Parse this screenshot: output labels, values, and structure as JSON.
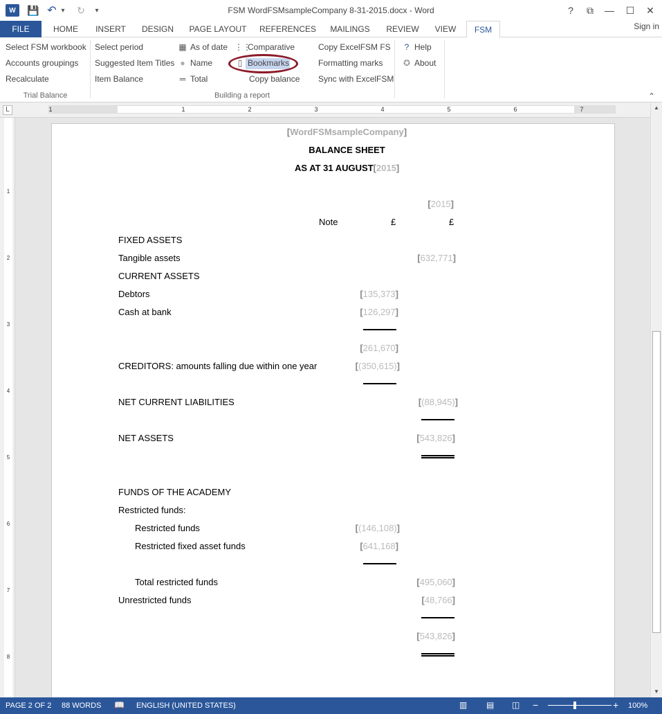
{
  "window": {
    "title": "FSM WordFSMsampleCompany 8-31-2015.docx - Word",
    "app_icon": "W",
    "help": "?",
    "restore": "⧉",
    "minimize": "—",
    "maximize": "☐",
    "close": "✕"
  },
  "quick_access": {
    "save": "💾",
    "undo": "↶",
    "undo_drop": "▾",
    "redo": "↻",
    "customize": "▾"
  },
  "tabs": [
    {
      "label": "FILE"
    },
    {
      "label": "HOME"
    },
    {
      "label": "INSERT"
    },
    {
      "label": "DESIGN"
    },
    {
      "label": "PAGE LAYOUT"
    },
    {
      "label": "REFERENCES"
    },
    {
      "label": "MAILINGS"
    },
    {
      "label": "REVIEW"
    },
    {
      "label": "VIEW"
    },
    {
      "label": "FSM"
    }
  ],
  "sign_in": "Sign in",
  "ribbon": {
    "trial_balance": {
      "label": "Trial Balance",
      "items": [
        "Select FSM workbook",
        "Accounts groupings",
        "Recalculate"
      ]
    },
    "building": {
      "label": "Building a report",
      "col1": [
        "Select period",
        "Suggested Item Titles",
        "Item Balance"
      ],
      "col2": [
        "As of date",
        "Name",
        "Total"
      ],
      "col3": [
        "Comparative",
        "Bookmarks",
        "Copy balance"
      ],
      "col4": [
        "Copy ExcelFSM FS",
        "Formatting marks",
        "Sync with ExcelFSM"
      ]
    },
    "help": {
      "items": [
        "Help",
        "About"
      ]
    },
    "collapse": "⌃"
  },
  "ruler": {
    "corner": "L",
    "numbers": [
      "1",
      "1",
      "2",
      "3",
      "4",
      "5",
      "6",
      "7"
    ]
  },
  "vruler": {
    "numbers": [
      "1",
      "2",
      "3",
      "4",
      "5",
      "6",
      "7",
      "8"
    ]
  },
  "document": {
    "company": "WordFSMsampleCompany",
    "heading": "BALANCE SHEET",
    "as_at": "AS AT 31 AUGUST",
    "year_bm": "2015",
    "col_year": "2015",
    "note_label": "Note",
    "currency1": "£",
    "currency2": "£",
    "rows": {
      "fixed_assets": "FIXED ASSETS",
      "tangible": "Tangible assets",
      "tangible_val": "632,771",
      "current_assets": "CURRENT ASSETS",
      "debtors": "Debtors",
      "debtors_val": "135,373",
      "cash": "Cash at bank",
      "cash_val": "126,297",
      "subtotal_val": "261,670",
      "creditors": "CREDITORS: amounts falling due within one year",
      "creditors_val": "(350,615)",
      "ncl": "NET CURRENT LIABILITIES",
      "ncl_val": "(88,945)",
      "net_assets": "NET ASSETS",
      "net_assets_val": "543,826",
      "funds": "FUNDS OF THE ACADEMY",
      "restricted_funds_hdr": "Restricted funds:",
      "restricted": "Restricted funds",
      "restricted_val": "(146,108)",
      "restricted_fixed": "Restricted fixed asset funds",
      "restricted_fixed_val": "641,168",
      "total_restricted": "Total restricted funds",
      "total_restricted_val": "495,060",
      "unrestricted": "Unrestricted funds",
      "unrestricted_val": "48,766",
      "grand_total_val": "543,826"
    }
  },
  "status": {
    "page": "PAGE 2 OF 2",
    "words": "88 WORDS",
    "proof_icon": "📖",
    "language": "ENGLISH (UNITED STATES)",
    "zoom_minus": "−",
    "zoom_plus": "+",
    "zoom": "100%"
  }
}
